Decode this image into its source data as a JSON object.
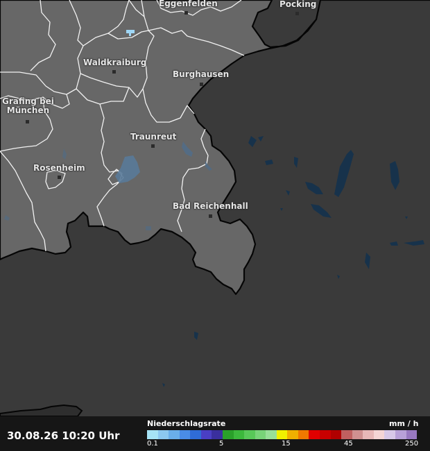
{
  "map": {
    "cities": [
      {
        "name": "Eggenfelden"
      },
      {
        "name": "Pocking"
      },
      {
        "name": "Waldkraiburg"
      },
      {
        "name": "Burghausen"
      },
      {
        "name": "Grafing bei\nMünchen"
      },
      {
        "name": "Traunreut"
      },
      {
        "name": "Rosenheim"
      },
      {
        "name": "Bad Reichenhall"
      }
    ]
  },
  "footer": {
    "timestamp": "30.08.26 10:20 Uhr",
    "legend_title": "Niederschlagsrate",
    "legend_unit": "mm / h",
    "scale_colors": [
      "#a6e3f5",
      "#8cc8f0",
      "#6aaeea",
      "#4a8ce6",
      "#2f6cd8",
      "#4a3fc4",
      "#3a2f9e",
      "#2aa02a",
      "#3cb83c",
      "#58c858",
      "#78d478",
      "#98e098",
      "#f0f000",
      "#f0b000",
      "#f07800",
      "#e00000",
      "#c80000",
      "#b00000",
      "#c06060",
      "#d09090",
      "#e8b8b8",
      "#f5d5d5",
      "#d8c8e8",
      "#b8a0d8",
      "#9878c0"
    ],
    "ticks": [
      "0.1",
      "5",
      "15",
      "45",
      "250"
    ]
  }
}
